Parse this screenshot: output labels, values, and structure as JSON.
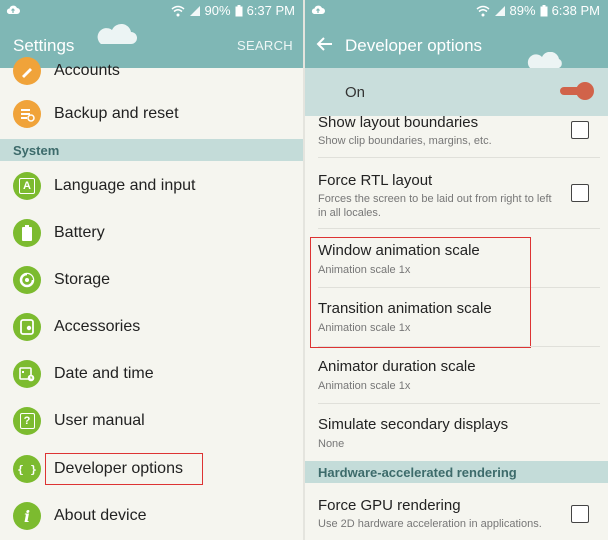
{
  "status_left": {
    "battery": "90%",
    "time": "6:37 PM"
  },
  "status_right": {
    "battery": "89%",
    "time": "6:38 PM"
  },
  "left_panel": {
    "title": "Settings",
    "search_label": "SEARCH",
    "items_top": [
      {
        "label": "Accounts",
        "icon": "accounts-icon"
      },
      {
        "label": "Backup and reset",
        "icon": "backup-reset-icon"
      }
    ],
    "section_system": "System",
    "system_items": [
      {
        "label": "Language and input",
        "icon": "language-input-icon",
        "glyph": "A"
      },
      {
        "label": "Battery",
        "icon": "battery-icon"
      },
      {
        "label": "Storage",
        "icon": "storage-icon"
      },
      {
        "label": "Accessories",
        "icon": "accessories-icon"
      },
      {
        "label": "Date and time",
        "icon": "date-time-icon"
      },
      {
        "label": "User manual",
        "icon": "user-manual-icon",
        "glyph": "?"
      },
      {
        "label": "Developer options",
        "icon": "developer-options-icon",
        "glyph": "{ }"
      },
      {
        "label": "About device",
        "icon": "about-device-icon",
        "glyph": "i"
      }
    ]
  },
  "right_panel": {
    "title": "Developer options",
    "switch_label": "On",
    "settings": [
      {
        "title": "Show layout boundaries",
        "subtitle": "Show clip boundaries, margins, etc."
      },
      {
        "title": "Force RTL layout",
        "subtitle": "Forces the screen to be laid out from right to left in all locales."
      },
      {
        "title": "Window animation scale",
        "subtitle": "Animation scale 1x"
      },
      {
        "title": "Transition animation scale",
        "subtitle": "Animation scale 1x"
      },
      {
        "title": "Animator duration scale",
        "subtitle": "Animation scale 1x"
      },
      {
        "title": "Simulate secondary displays",
        "subtitle": "None"
      },
      {
        "title": "Force GPU rendering",
        "subtitle": "Use 2D hardware acceleration in applications."
      }
    ],
    "section_hw": "Hardware-accelerated rendering"
  },
  "colors": {
    "header": "#7fb7b5",
    "section": "#c4dcd9",
    "icon_green": "#7cbb2f",
    "icon_orange": "#f0a33a",
    "switch": "#d1634a",
    "highlight": "#dd3333"
  }
}
